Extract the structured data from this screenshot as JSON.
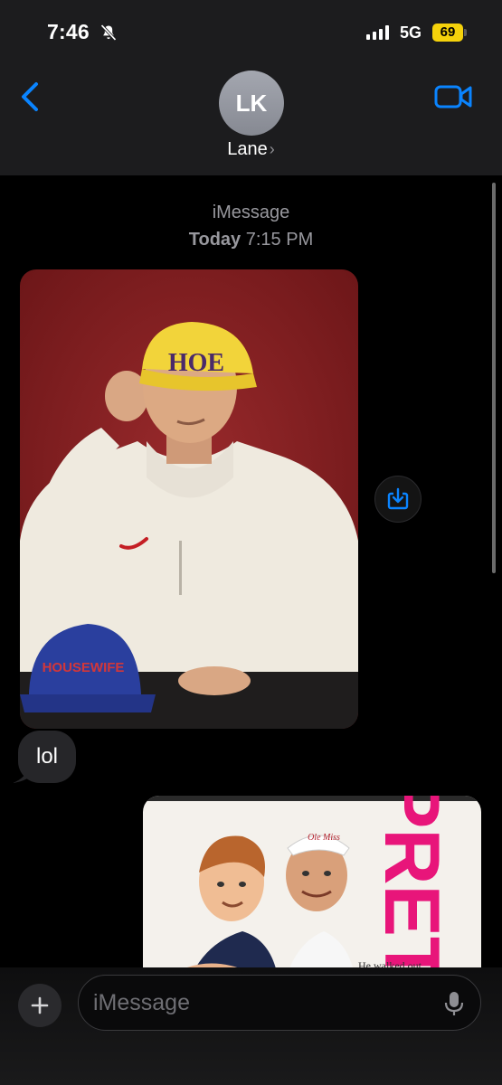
{
  "status_bar": {
    "time": "7:46",
    "network": "5G",
    "battery": "69",
    "icons": [
      "bell-slash-icon",
      "signal-bars-icon",
      "battery-icon"
    ]
  },
  "header": {
    "avatar_initials": "LK",
    "contact_name": "Lane",
    "chevron": "›",
    "icons": [
      "back-chevron-icon",
      "video-camera-icon"
    ],
    "accent_color": "#0a84ff"
  },
  "conversation": {
    "service_label": "iMessage",
    "day": "Today",
    "time": "7:15 PM",
    "messages": [
      {
        "type": "image",
        "direction": "received",
        "hat_text": "HOE",
        "second_hat_text": "HOUSEWIFE"
      },
      {
        "type": "text",
        "direction": "received",
        "text": "lol"
      },
      {
        "type": "image",
        "direction": "sent",
        "poster_title": "PRETT",
        "tagline": "He walked out",
        "cap_text": "Ole Miss"
      }
    ]
  },
  "input": {
    "placeholder": "iMessage",
    "icons": [
      "plus-icon",
      "microphone-icon"
    ]
  }
}
